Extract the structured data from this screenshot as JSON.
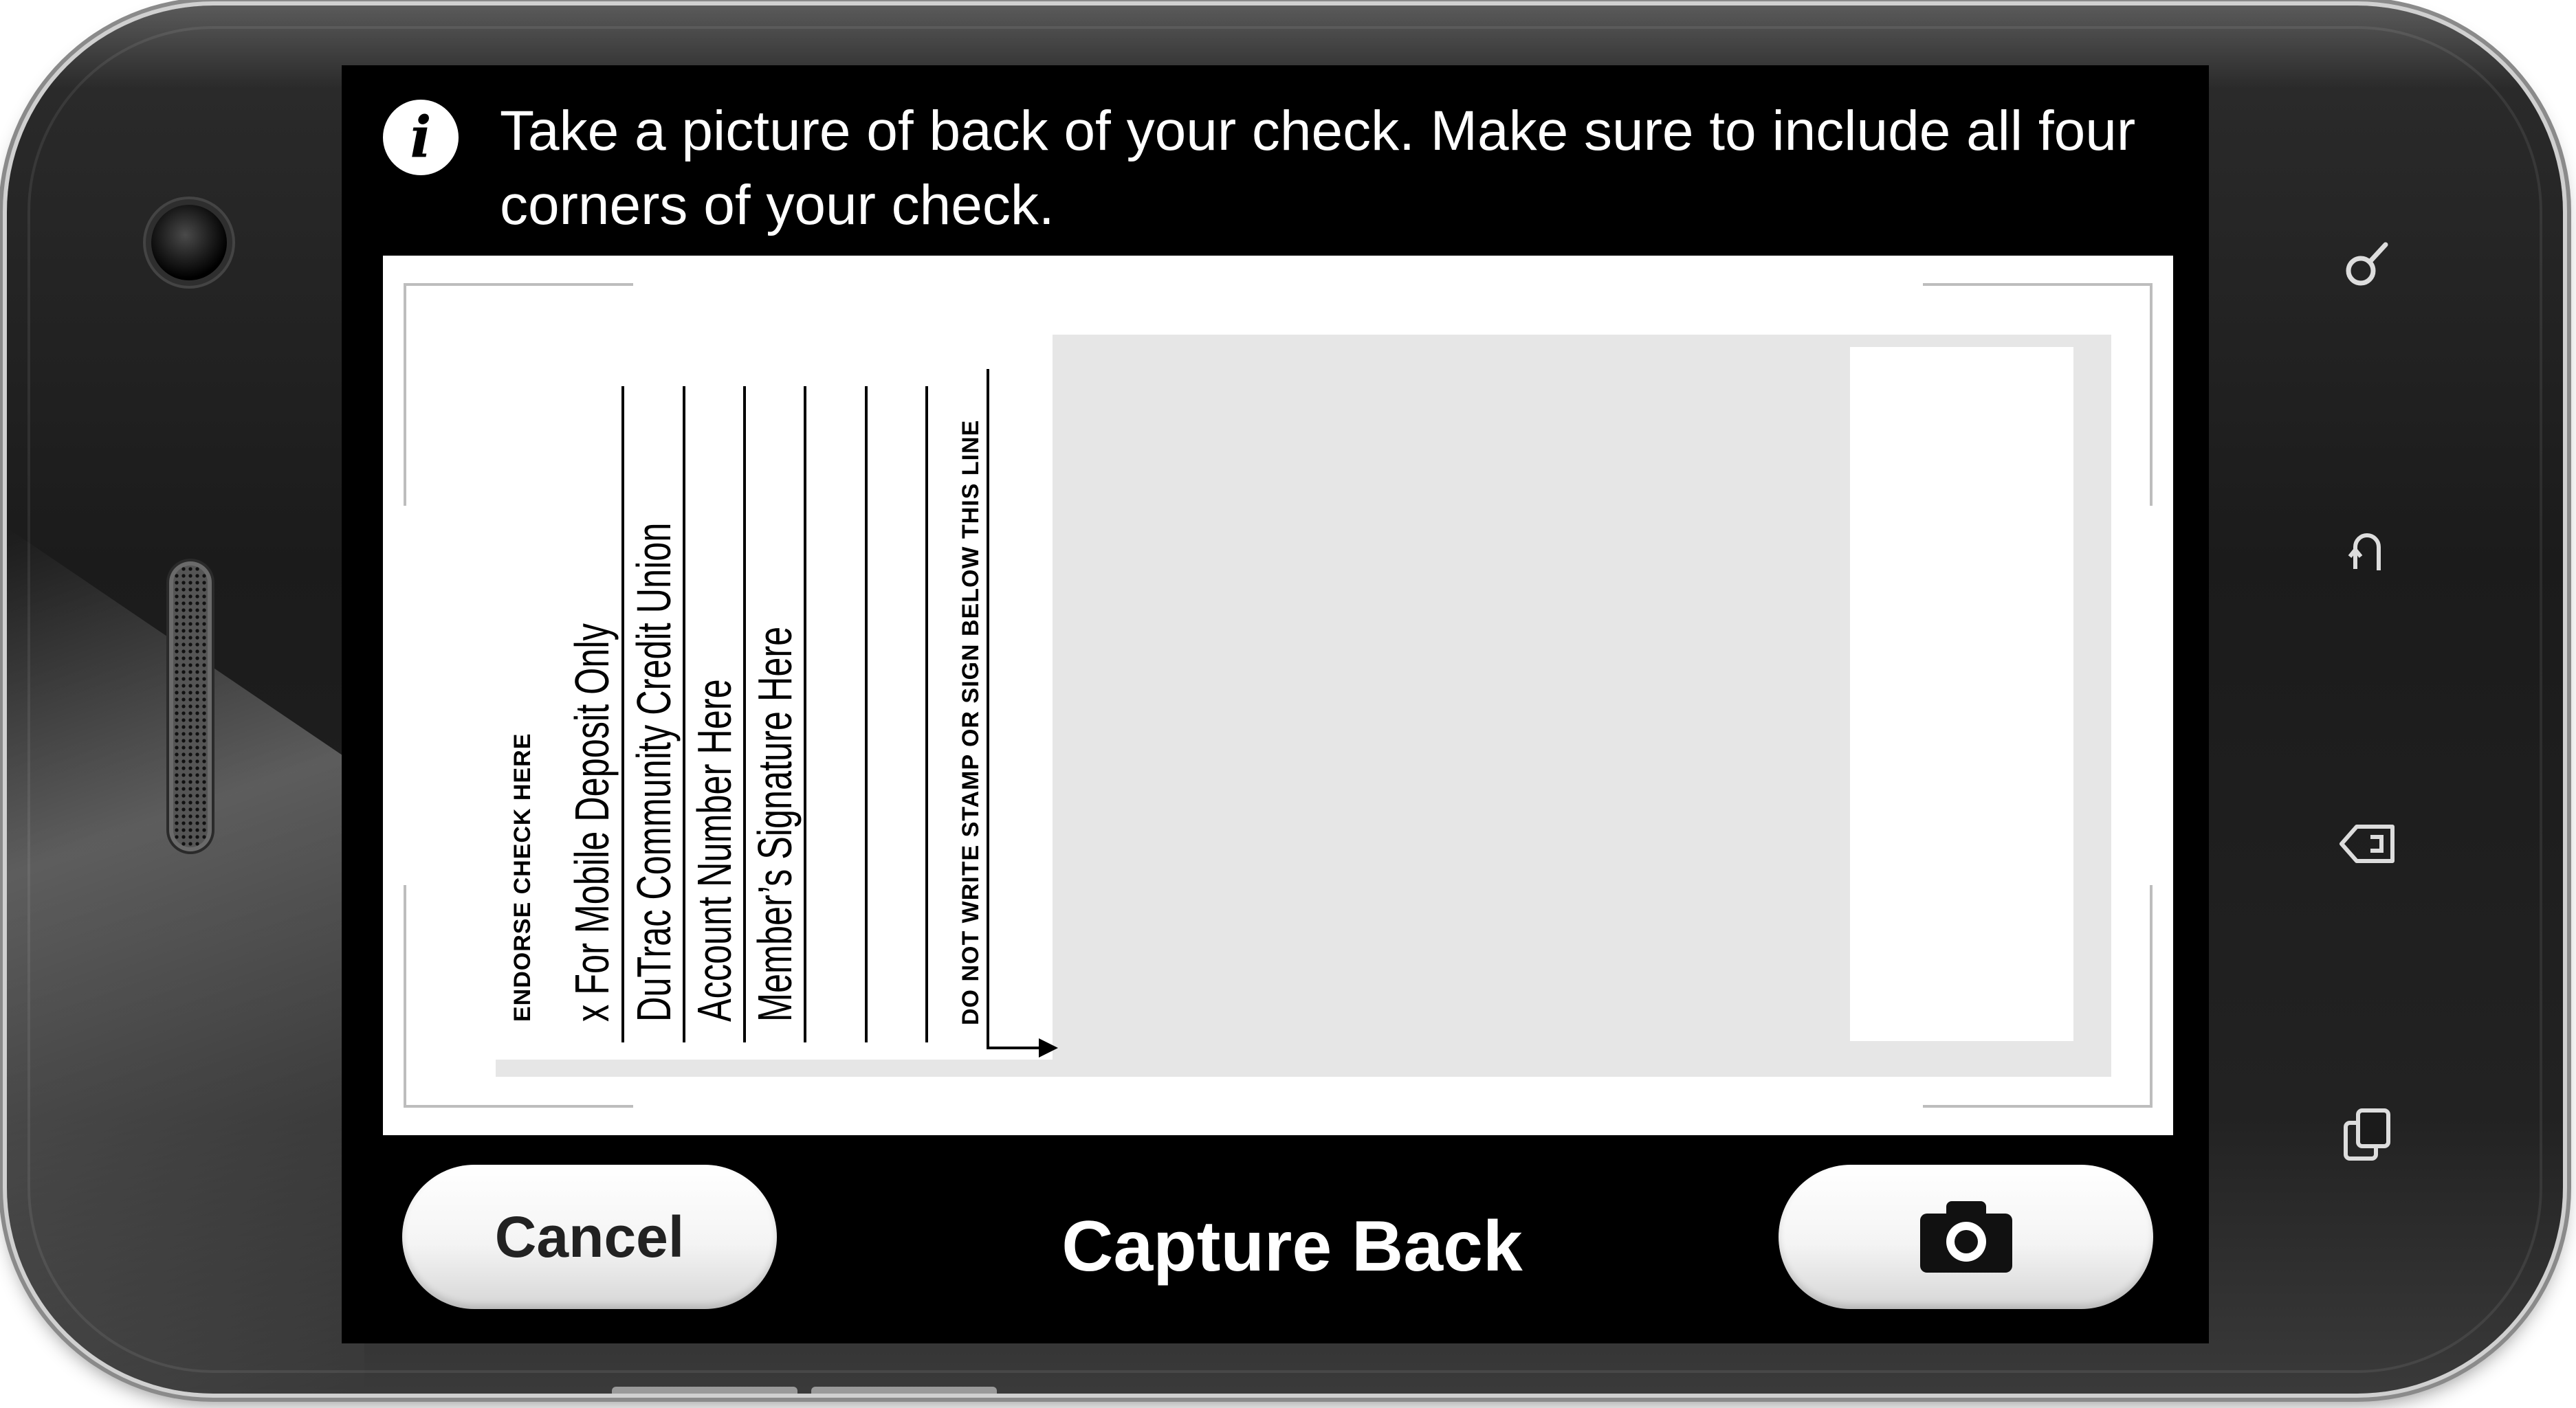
{
  "screen": {
    "instruction": "Take a picture of back of your check. Make sure to include all four corners of your check.",
    "info_icon_glyph": "i",
    "title": "Capture Back",
    "cancel_label": "Cancel",
    "capture_icon": "camera-icon"
  },
  "check": {
    "heading": "ENDORSE CHECK HERE",
    "lines": [
      "x For Mobile Deposit Only",
      "DuTrac Community Credit Union",
      "Account Number Here",
      "Member’s Signature Here"
    ],
    "warning": "DO NOT WRITE STAMP OR SIGN BELOW THIS LINE"
  },
  "device": {
    "nav_keys": [
      "search-key-icon",
      "home-key-icon",
      "back-key-icon",
      "recent-apps-key-icon"
    ]
  },
  "colors": {
    "screen_background": "#000000",
    "check_background": "#e6e6e6",
    "button_face": "#ffffff",
    "text_light": "#ffffff"
  }
}
